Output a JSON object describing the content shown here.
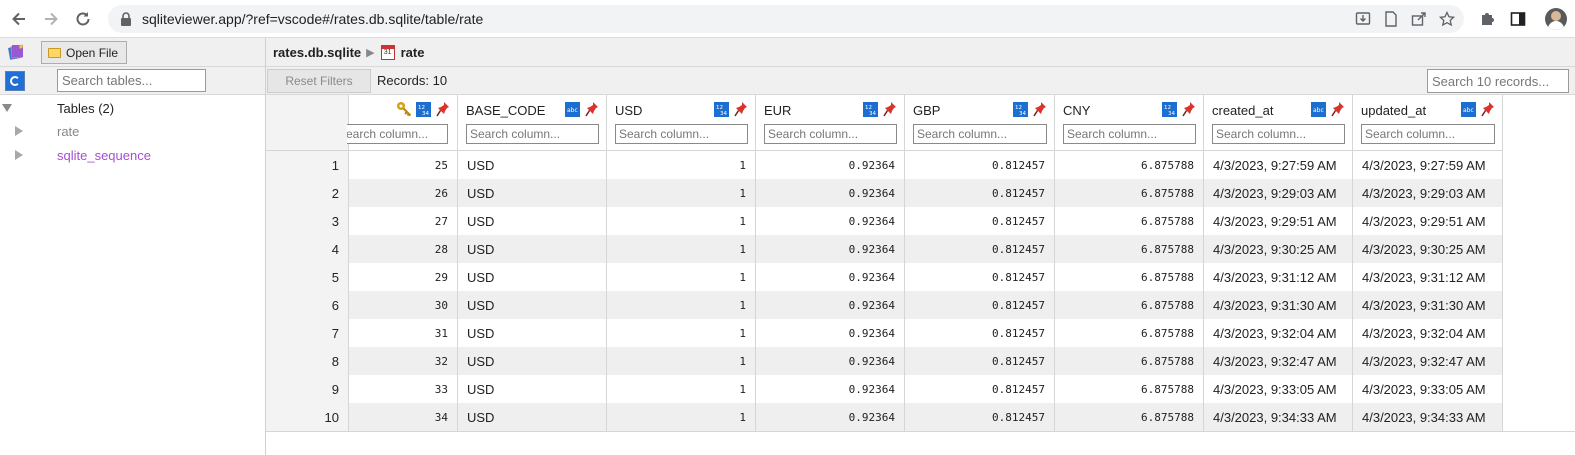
{
  "browser": {
    "url": "sqliteviewer.app/?ref=vscode#/rates.db.sqlite/table/rate"
  },
  "sidebar": {
    "open_file_label": "Open File",
    "search_placeholder": "Search tables...",
    "tables_header": "Tables (2)",
    "tables": [
      {
        "label": "rate",
        "color": "#888888"
      },
      {
        "label": "sqlite_sequence",
        "color": "#a64fd0"
      }
    ]
  },
  "breadcrumb": {
    "database": "rates.db.sqlite",
    "table": "rate",
    "calendar_glyph": "31"
  },
  "toolbar": {
    "reset_label": "Reset Filters",
    "records_label": "Records: 10",
    "search_placeholder": "Search 10 records..."
  },
  "columns": [
    {
      "label": "",
      "search": "Search column..."
    },
    {
      "label": "BASE_CODE",
      "search": "Search column..."
    },
    {
      "label": "USD",
      "search": "Search column..."
    },
    {
      "label": "EUR",
      "search": "Search column..."
    },
    {
      "label": "GBP",
      "search": "Search column..."
    },
    {
      "label": "CNY",
      "search": "Search column..."
    },
    {
      "label": "created_at",
      "search": "Search column..."
    },
    {
      "label": "updated_at",
      "search": "Search column..."
    }
  ],
  "rows": [
    {
      "n": "1",
      "id": "25",
      "base": "USD",
      "usd": "1",
      "eur": "0.92364",
      "gbp": "0.812457",
      "cny": "6.875788",
      "created": "4/3/2023, 9:27:59 AM",
      "updated": "4/3/2023, 9:27:59 AM"
    },
    {
      "n": "2",
      "id": "26",
      "base": "USD",
      "usd": "1",
      "eur": "0.92364",
      "gbp": "0.812457",
      "cny": "6.875788",
      "created": "4/3/2023, 9:29:03 AM",
      "updated": "4/3/2023, 9:29:03 AM"
    },
    {
      "n": "3",
      "id": "27",
      "base": "USD",
      "usd": "1",
      "eur": "0.92364",
      "gbp": "0.812457",
      "cny": "6.875788",
      "created": "4/3/2023, 9:29:51 AM",
      "updated": "4/3/2023, 9:29:51 AM"
    },
    {
      "n": "4",
      "id": "28",
      "base": "USD",
      "usd": "1",
      "eur": "0.92364",
      "gbp": "0.812457",
      "cny": "6.875788",
      "created": "4/3/2023, 9:30:25 AM",
      "updated": "4/3/2023, 9:30:25 AM"
    },
    {
      "n": "5",
      "id": "29",
      "base": "USD",
      "usd": "1",
      "eur": "0.92364",
      "gbp": "0.812457",
      "cny": "6.875788",
      "created": "4/3/2023, 9:31:12 AM",
      "updated": "4/3/2023, 9:31:12 AM"
    },
    {
      "n": "6",
      "id": "30",
      "base": "USD",
      "usd": "1",
      "eur": "0.92364",
      "gbp": "0.812457",
      "cny": "6.875788",
      "created": "4/3/2023, 9:31:30 AM",
      "updated": "4/3/2023, 9:31:30 AM"
    },
    {
      "n": "7",
      "id": "31",
      "base": "USD",
      "usd": "1",
      "eur": "0.92364",
      "gbp": "0.812457",
      "cny": "6.875788",
      "created": "4/3/2023, 9:32:04 AM",
      "updated": "4/3/2023, 9:32:04 AM"
    },
    {
      "n": "8",
      "id": "32",
      "base": "USD",
      "usd": "1",
      "eur": "0.92364",
      "gbp": "0.812457",
      "cny": "6.875788",
      "created": "4/3/2023, 9:32:47 AM",
      "updated": "4/3/2023, 9:32:47 AM"
    },
    {
      "n": "9",
      "id": "33",
      "base": "USD",
      "usd": "1",
      "eur": "0.92364",
      "gbp": "0.812457",
      "cny": "6.875788",
      "created": "4/3/2023, 9:33:05 AM",
      "updated": "4/3/2023, 9:33:05 AM"
    },
    {
      "n": "10",
      "id": "34",
      "base": "USD",
      "usd": "1",
      "eur": "0.92364",
      "gbp": "0.812457",
      "cny": "6.875788",
      "created": "4/3/2023, 9:34:33 AM",
      "updated": "4/3/2023, 9:34:33 AM"
    }
  ],
  "colors": {
    "accent": "#1c6fd1",
    "pin": "#d9342b",
    "key": "#d4a017"
  }
}
